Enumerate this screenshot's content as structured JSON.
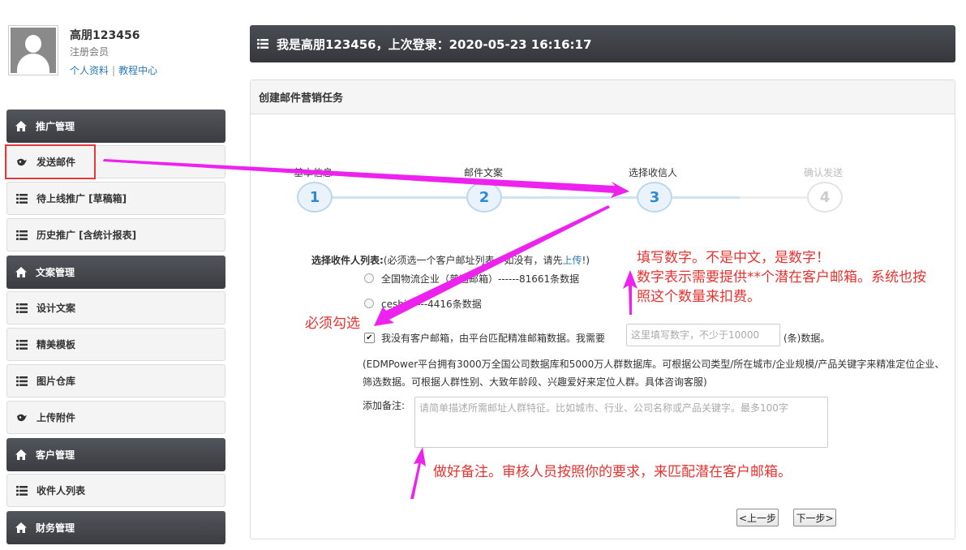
{
  "user": {
    "name": "高朋123456",
    "role": "注册会员",
    "profile_link": "个人资料",
    "separator": "|",
    "tutorial_link": "教程中心"
  },
  "sidebar": {
    "items": [
      {
        "label": "推广管理",
        "type": "header",
        "icon": "home-icon"
      },
      {
        "label": "发送邮件",
        "type": "item",
        "icon": "send-icon"
      },
      {
        "label": "待上线推广 [草稿箱]",
        "type": "item",
        "icon": "list-icon"
      },
      {
        "label": "历史推广 [含统计报表]",
        "type": "item",
        "icon": "list-icon"
      },
      {
        "label": "文案管理",
        "type": "header",
        "icon": "home-icon"
      },
      {
        "label": "设计文案",
        "type": "item",
        "icon": "list-icon"
      },
      {
        "label": "精美模板",
        "type": "item",
        "icon": "list-icon"
      },
      {
        "label": "图片仓库",
        "type": "item",
        "icon": "list-icon"
      },
      {
        "label": "上传附件",
        "type": "item",
        "icon": "send-icon"
      },
      {
        "label": "客户管理",
        "type": "header",
        "icon": "home-icon"
      },
      {
        "label": "收件人列表",
        "type": "item",
        "icon": "list-icon"
      },
      {
        "label": "财务管理",
        "type": "header",
        "icon": "home-icon"
      }
    ]
  },
  "header": {
    "title": "我是高朋123456，上次登录：2020-05-23 16:16:17"
  },
  "panel": {
    "title": "创建邮件营销任务"
  },
  "steps": [
    {
      "label": "基本信息",
      "number": "1",
      "active": true
    },
    {
      "label": "邮件文案",
      "number": "2",
      "active": true
    },
    {
      "label": "选择收信人",
      "number": "3",
      "active": true
    },
    {
      "label": "确认发送",
      "number": "4",
      "active": false
    }
  ],
  "form": {
    "list_label_bold": "选择收件人列表:",
    "list_label_hint": "(必须选一个客户邮址列表。如没有，请先",
    "upload_link": "上传",
    "list_label_end": "!)",
    "option1": "全国物流企业（普通邮箱）------81661条数据",
    "option2": "ceshi------4416条数据",
    "checkbox_checked": true,
    "checkbox_label": "我没有客户邮箱，由平台匹配精准邮箱数据。我需要",
    "count_placeholder": "这里填写数字，不少于10000",
    "count_suffix": "(条)数据。",
    "description": "(EDMPower平台拥有3000万全国公司数据库和5000万人群数据库。可根据公司类型/所在城市/企业规模/产品关键字来精准定位企业、筛选数据。可根据人群性别、大致年龄段、兴趣爱好来定位人群。具体咨询客服)",
    "note_label": "添加备注:",
    "note_placeholder": "请简单描述所需邮址人群特征。比如城市、行业、公司名称或产品关键字。最多100字",
    "prev_button": "<上一步",
    "next_button": "下一步>"
  },
  "annotations": {
    "fill_number_line1": "填写数字。不是中文，是数字！",
    "fill_number_line2": "数字表示需要提供**个潜在客户邮箱。系统也按",
    "fill_number_line3": "照这个数量来扣费。",
    "must_check": "必须勾选",
    "remark": "做好备注。审核人员按照你的要求，来匹配潜在客户邮箱。"
  },
  "colors": {
    "annotation_red": "#e8322f",
    "arrow_magenta": "#ee22ee",
    "step_blue": "#2f8ad3",
    "sidebar_dark": "#3f4247"
  }
}
